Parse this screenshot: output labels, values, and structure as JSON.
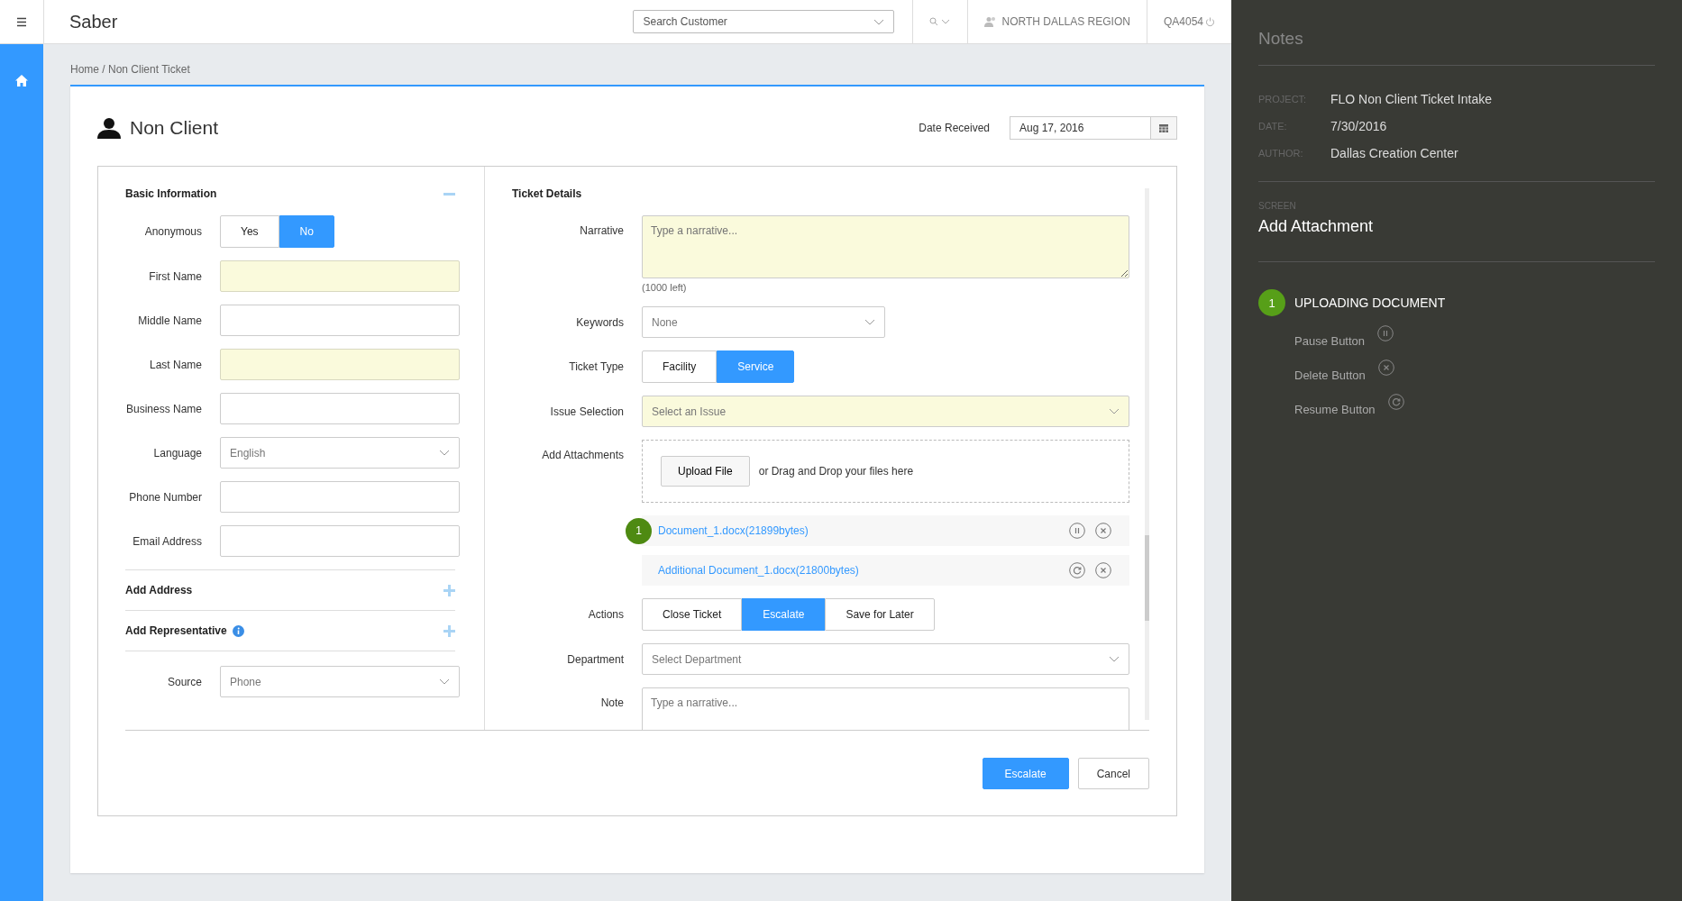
{
  "topbar": {
    "title": "Saber",
    "search": {
      "placeholder": "Search Customer"
    },
    "region": "NORTH DALLAS REGION",
    "user": "QA4054"
  },
  "breadcrumb": "Home / Non Client Ticket",
  "page": {
    "title": "Non Client",
    "date_label": "Date Received",
    "date_value": "Aug 17, 2016"
  },
  "basic_info": {
    "title": "Basic Information",
    "expanded": true,
    "fields": [
      {
        "kind": "toggle",
        "label": "Anonymous",
        "options": [
          {
            "label": "Yes",
            "selected": false
          },
          {
            "label": "No",
            "selected": true
          }
        ]
      },
      {
        "kind": "input",
        "label": "First Name",
        "highlighted": true
      },
      {
        "kind": "input",
        "label": "Middle Name",
        "highlighted": false
      },
      {
        "kind": "input",
        "label": "Last Name",
        "highlighted": true
      },
      {
        "kind": "input",
        "label": "Business Name",
        "highlighted": false
      },
      {
        "kind": "select",
        "label": "Language",
        "value": "English"
      },
      {
        "kind": "input",
        "label": "Phone Number",
        "highlighted": false
      },
      {
        "kind": "input",
        "label": "Email Address",
        "highlighted": false
      }
    ]
  },
  "sections": [
    {
      "title": "Add Address",
      "info": false,
      "expanded": false
    },
    {
      "title": "Add Representative",
      "info": true,
      "expanded": false
    }
  ],
  "source": {
    "label": "Source",
    "value": "Phone"
  },
  "ticket_details": {
    "title": "Ticket Details",
    "narrative": {
      "label": "Narrative",
      "placeholder": "Type a narrative...",
      "counter": "(1000 left)",
      "highlighted": true
    },
    "keywords": {
      "label": "Keywords",
      "value": "None"
    },
    "ticket_type": {
      "label": "Ticket Type",
      "options": [
        {
          "label": "Facility",
          "selected": false
        },
        {
          "label": "Service",
          "selected": true
        }
      ]
    },
    "issue": {
      "label": "Issue Selection",
      "placeholder": "Select an Issue",
      "highlighted": true
    },
    "attachments": {
      "label": "Add Attachments",
      "upload_button": "Upload File",
      "drop_text": "or Drag and Drop your files here",
      "files": [
        {
          "name": "Document_1.docx(21899bytes)",
          "badge": "1",
          "kind": "uploading"
        },
        {
          "name": "Additional Document_1.docx(21800bytes)",
          "kind": "paused"
        }
      ]
    },
    "actions": {
      "label": "Actions",
      "options": [
        {
          "label": "Close Ticket",
          "selected": false
        },
        {
          "label": "Escalate",
          "selected": true
        },
        {
          "label": "Save for Later",
          "selected": false
        }
      ]
    },
    "department": {
      "label": "Department",
      "placeholder": "Select Department"
    },
    "note": {
      "label": "Note",
      "placeholder": "Type a narrative..."
    }
  },
  "footer_buttons": [
    {
      "label": "Escalate",
      "kind": "primary"
    },
    {
      "label": "Cancel",
      "kind": "secondary"
    }
  ],
  "notes": {
    "title": "Notes",
    "meta": [
      {
        "label": "PROJECT:",
        "value": "FLO Non Client Ticket Intake"
      },
      {
        "label": "DATE:",
        "value": "7/30/2016"
      },
      {
        "label": "AUTHOR:",
        "value": "Dallas Creation Center"
      }
    ],
    "screen_label": "SCREEN",
    "screen_title": "Add Attachment",
    "step": {
      "badge": "1",
      "title": "UPLOADING DOCUMENT",
      "items": [
        {
          "label": "Pause Button"
        },
        {
          "label": "Delete Button"
        },
        {
          "label": "Resume Button"
        }
      ]
    }
  }
}
